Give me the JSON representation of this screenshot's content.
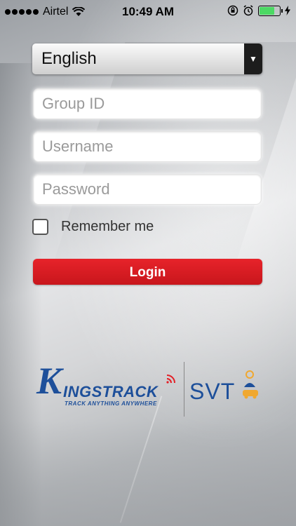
{
  "status_bar": {
    "carrier": "Airtel",
    "time": "10:49 AM"
  },
  "form": {
    "language_value": "English",
    "group_id_placeholder": "Group ID",
    "username_placeholder": "Username",
    "password_placeholder": "Password",
    "remember_label": "Remember me",
    "login_label": "Login"
  },
  "branding": {
    "kingstrack_initial": "K",
    "kingstrack_name": "INGSTRACK",
    "kingstrack_tagline": "TRACK ANYTHING ANYWHERE",
    "svt_name": "SVT",
    "primary_color": "#1d4f9a",
    "accent_color": "#e31f26"
  }
}
